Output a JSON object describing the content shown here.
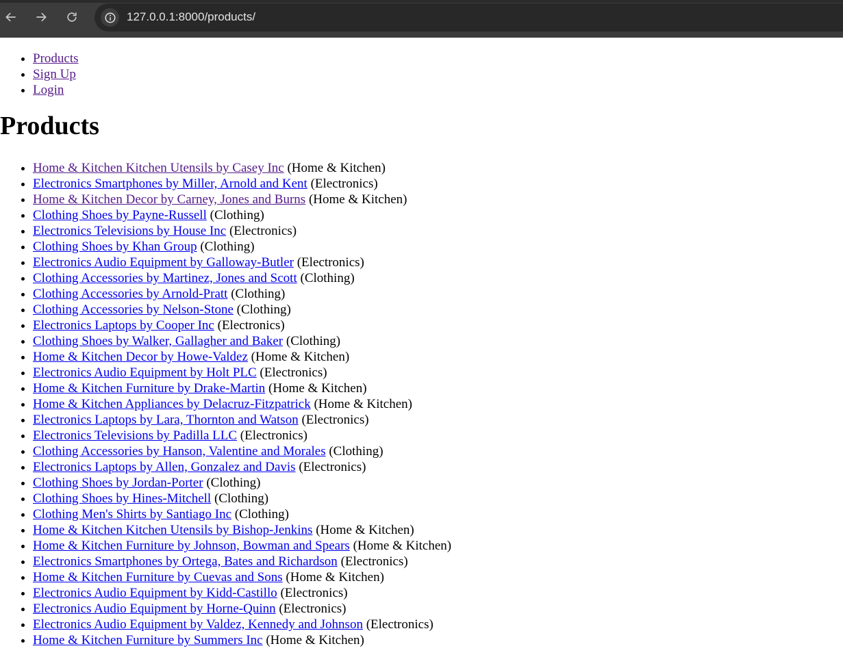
{
  "browser": {
    "url": "127.0.0.1:8000/products/"
  },
  "nav": [
    {
      "label": "Products"
    },
    {
      "label": "Sign Up"
    },
    {
      "label": "Login"
    }
  ],
  "page_title": "Products",
  "products": [
    {
      "name": "Home & Kitchen Kitchen Utensils by Casey Inc",
      "category": " (Home & Kitchen)",
      "visited": true
    },
    {
      "name": "Electronics Smartphones by Miller, Arnold and Kent",
      "category": " (Electronics)",
      "visited": false
    },
    {
      "name": "Home & Kitchen Decor by Carney, Jones and Burns",
      "category": " (Home & Kitchen)",
      "visited": true
    },
    {
      "name": "Clothing Shoes by Payne-Russell",
      "category": " (Clothing)",
      "visited": false
    },
    {
      "name": "Electronics Televisions by House Inc",
      "category": " (Electronics)",
      "visited": false
    },
    {
      "name": "Clothing Shoes by Khan Group",
      "category": " (Clothing)",
      "visited": false
    },
    {
      "name": "Electronics Audio Equipment by Galloway-Butler",
      "category": " (Electronics)",
      "visited": false
    },
    {
      "name": "Clothing Accessories by Martinez, Jones and Scott",
      "category": " (Clothing)",
      "visited": false
    },
    {
      "name": "Clothing Accessories by Arnold-Pratt",
      "category": " (Clothing)",
      "visited": false
    },
    {
      "name": "Clothing Accessories by Nelson-Stone",
      "category": " (Clothing)",
      "visited": false
    },
    {
      "name": "Electronics Laptops by Cooper Inc",
      "category": " (Electronics)",
      "visited": false
    },
    {
      "name": "Clothing Shoes by Walker, Gallagher and Baker",
      "category": " (Clothing)",
      "visited": false
    },
    {
      "name": "Home & Kitchen Decor by Howe-Valdez",
      "category": " (Home & Kitchen)",
      "visited": false
    },
    {
      "name": "Electronics Audio Equipment by Holt PLC",
      "category": " (Electronics)",
      "visited": false
    },
    {
      "name": "Home & Kitchen Furniture by Drake-Martin",
      "category": " (Home & Kitchen)",
      "visited": false
    },
    {
      "name": "Home & Kitchen Appliances by Delacruz-Fitzpatrick",
      "category": " (Home & Kitchen)",
      "visited": false
    },
    {
      "name": "Electronics Laptops by Lara, Thornton and Watson",
      "category": " (Electronics)",
      "visited": false
    },
    {
      "name": "Electronics Televisions by Padilla LLC",
      "category": " (Electronics)",
      "visited": false
    },
    {
      "name": "Clothing Accessories by Hanson, Valentine and Morales",
      "category": " (Clothing)",
      "visited": false
    },
    {
      "name": "Electronics Laptops by Allen, Gonzalez and Davis",
      "category": " (Electronics)",
      "visited": false
    },
    {
      "name": "Clothing Shoes by Jordan-Porter",
      "category": " (Clothing)",
      "visited": false
    },
    {
      "name": "Clothing Shoes by Hines-Mitchell",
      "category": " (Clothing)",
      "visited": false
    },
    {
      "name": "Clothing Men's Shirts by Santiago Inc",
      "category": " (Clothing)",
      "visited": false
    },
    {
      "name": "Home & Kitchen Kitchen Utensils by Bishop-Jenkins",
      "category": " (Home & Kitchen)",
      "visited": false
    },
    {
      "name": "Home & Kitchen Furniture by Johnson, Bowman and Spears",
      "category": " (Home & Kitchen)",
      "visited": false
    },
    {
      "name": "Electronics Smartphones by Ortega, Bates and Richardson",
      "category": " (Electronics)",
      "visited": false
    },
    {
      "name": "Home & Kitchen Furniture by Cuevas and Sons",
      "category": " (Home & Kitchen)",
      "visited": false
    },
    {
      "name": "Electronics Audio Equipment by Kidd-Castillo",
      "category": " (Electronics)",
      "visited": false
    },
    {
      "name": "Electronics Audio Equipment by Horne-Quinn",
      "category": " (Electronics)",
      "visited": false
    },
    {
      "name": "Electronics Audio Equipment by Valdez, Kennedy and Johnson",
      "category": " (Electronics)",
      "visited": false
    },
    {
      "name": "Home & Kitchen Furniture by Summers Inc",
      "category": " (Home & Kitchen)",
      "visited": false
    }
  ],
  "colors": {
    "link": "#0000ee",
    "visited_link": "#551a8b",
    "toolbar": "#3c3c3c",
    "omnibox": "#282828"
  }
}
